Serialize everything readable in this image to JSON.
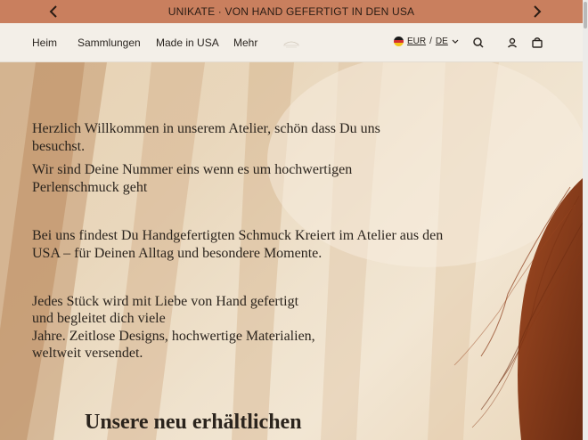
{
  "announcement": {
    "text": "UNIKATE · VON HAND GEFERTIGT IN DEN USA",
    "prev_icon": "chevron-left-icon",
    "next_icon": "chevron-right-icon"
  },
  "nav": {
    "items": [
      {
        "label": "Heim"
      },
      {
        "label": "Sammlungen"
      },
      {
        "label": "Made in USA"
      },
      {
        "label": "Mehr"
      }
    ]
  },
  "locale": {
    "currency": "EUR",
    "separator": "/",
    "language": "DE"
  },
  "header_icons": [
    "search-icon",
    "account-icon",
    "cart-icon"
  ],
  "hero": {
    "paragraph_1": "Herzlich Willkommen in unserem Atelier, schön dass Du uns besuchst.",
    "paragraph_2": "Wir sind Deine Nummer eins wenn es um hochwertigen Perlenschmuck geht",
    "paragraph_3": "Bei uns findest Du Handgefertigten Schmuck Kreiert im Atelier aus den USA – für Deinen Alltag und besondere Momente.",
    "paragraph_4_line_1": "Jedes Stück wird mit Liebe von Hand gefertigt",
    "paragraph_4_line_2": "und begleitet dich viele",
    "paragraph_4_line_3": "Jahre. Zeitlose Designs, hochwertige Materialien,",
    "paragraph_4_line_4": "weltweit versendet.",
    "headline": "Unsere neu erhältlichen"
  },
  "colors": {
    "announcement_bg": "#c97f5e",
    "header_bg": "#f3efe8",
    "text": "#2b241d"
  }
}
